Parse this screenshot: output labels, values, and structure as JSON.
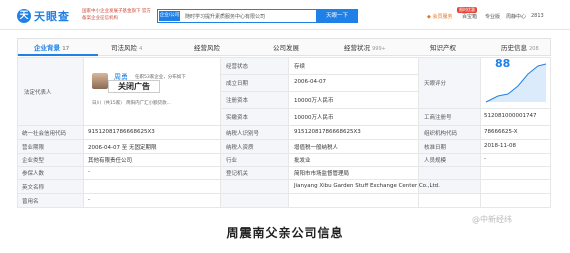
{
  "header": {
    "logo_mark": "天",
    "logo": "天眼查",
    "slogan": "国家中小企业发展子基金旗下 官方备案企业征信机构",
    "search_tag": "企业/公司",
    "search_query": "随时学习提升素质服务中心有限公司",
    "search_button": "天眼一下",
    "nav": [
      "会员服务",
      "百宝箱",
      "专业版",
      "周静中心",
      "2813"
    ],
    "badge": "限时优惠"
  },
  "tabs": [
    {
      "label": "企业背景",
      "count": "17"
    },
    {
      "label": "司法风险",
      "count": "4"
    },
    {
      "label": "经营风险",
      "count": ""
    },
    {
      "label": "公司发展",
      "count": ""
    },
    {
      "label": "经营状况",
      "count": "999+"
    },
    {
      "label": "知识产权",
      "count": ""
    },
    {
      "label": "历史信息",
      "count": "208"
    }
  ],
  "legal_rep": {
    "label": "法定代表人",
    "name": "周勇",
    "roles": "任职53家企业，分布如下",
    "detail": "日川（共15家）  简阳内广汇小额贷款...",
    "ad": "关闭广告"
  },
  "fields": [
    {
      "label": "经营状态",
      "value": "存续"
    },
    {
      "label": "成立日期",
      "value": "2006-04-07"
    },
    {
      "label": "注册资本",
      "value": "10000万人民币"
    },
    {
      "label": "实缴资本",
      "value": "10000万人民币"
    },
    {
      "label": "天眼评分",
      "value": "88"
    },
    {
      "label": "工商注册号",
      "value": "512081000001747"
    },
    {
      "label": "统一社会信用代码",
      "value": "91512081786668625X3"
    },
    {
      "label": "纳税人识别号",
      "value": "91512081786668625X3"
    },
    {
      "label": "组织机构代码",
      "value": "78666625-X"
    },
    {
      "label": "营业期限",
      "value": "2006-04-07 至 无固定期限"
    },
    {
      "label": "纳税人资质",
      "value": "增值税一般纳税人"
    },
    {
      "label": "核准日期",
      "value": "2018-11-08"
    },
    {
      "label": "企业类型",
      "value": "其他有限责任公司"
    },
    {
      "label": "行业",
      "value": "批发业"
    },
    {
      "label": "人员规模",
      "value": "-"
    },
    {
      "label": "参保人数",
      "value": "-"
    },
    {
      "label": "登记机关",
      "value": "简阳市市场监督管理局"
    },
    {
      "label": "英文名称",
      "value": "Jianyang Xibu Garden Stuff Exchange Center Co.,Ltd."
    },
    {
      "label": "曾用名",
      "value": "-"
    }
  ],
  "watermark": "@中新经纬",
  "caption": "周震南父亲公司信息"
}
